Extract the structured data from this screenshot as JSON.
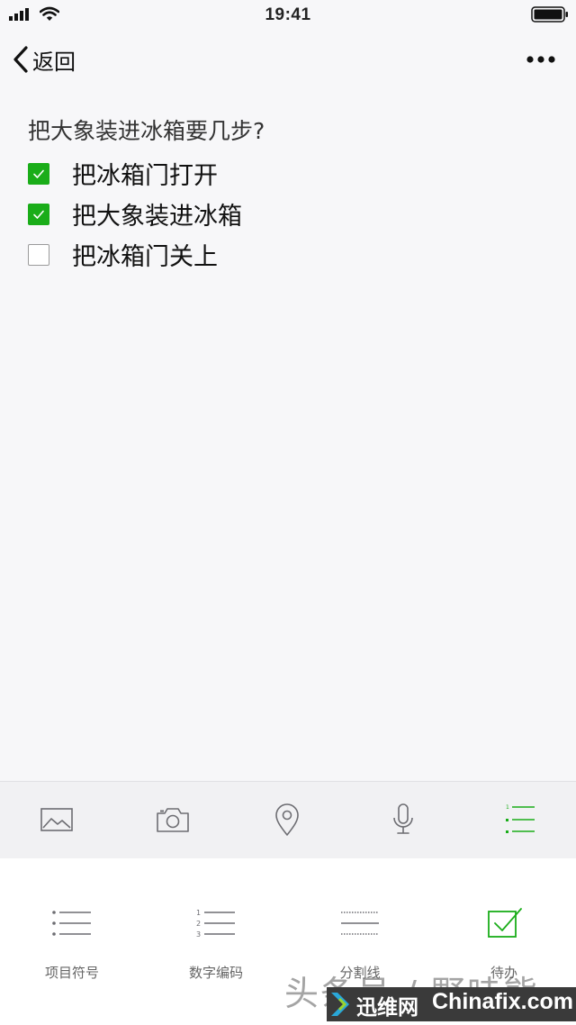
{
  "status_bar": {
    "time": "19:41",
    "icons": [
      "signal-icon",
      "wifi-icon",
      "battery-icon"
    ]
  },
  "nav": {
    "back_label": "返回",
    "back_icon": "chevron-left-icon",
    "more_icon": "more-dots-icon"
  },
  "note": {
    "title": "把大象装进冰箱要几步?",
    "todos": [
      {
        "text": "把冰箱门打开",
        "checked": true
      },
      {
        "text": "把大象装进冰箱",
        "checked": true
      },
      {
        "text": "把冰箱门关上",
        "checked": false
      }
    ]
  },
  "toolbar": {
    "tools": [
      {
        "icon": "image-icon",
        "active": false
      },
      {
        "icon": "camera-icon",
        "active": false
      },
      {
        "icon": "location-pin-icon",
        "active": false
      },
      {
        "icon": "microphone-icon",
        "active": false
      },
      {
        "icon": "list-format-icon",
        "active": true
      }
    ]
  },
  "format_panel": {
    "options": [
      {
        "label": "项目符号",
        "icon": "bullet-list-icon"
      },
      {
        "label": "数字编码",
        "icon": "numbered-list-icon"
      },
      {
        "label": "分割线",
        "icon": "divider-line-icon"
      },
      {
        "label": "待办",
        "icon": "todo-checkbox-icon"
      }
    ]
  },
  "watermark": {
    "source_text": "头条号 / 野哇熊",
    "brand_cn": "迅维网",
    "brand_en": "Chinafix.com"
  },
  "colors": {
    "accent_green": "#1aad19",
    "background": "#f7f7f9",
    "toolbar_bg": "#f1f1f3",
    "icon_gray": "#6d6d72",
    "label_gray": "#666666"
  }
}
